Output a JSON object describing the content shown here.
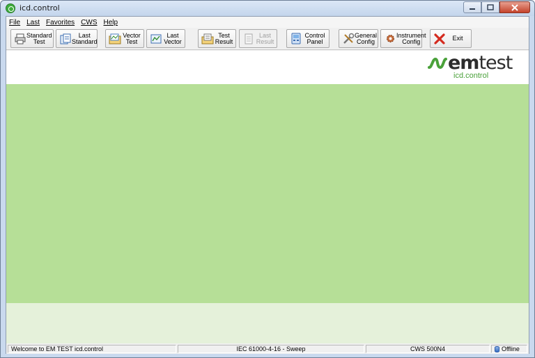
{
  "window": {
    "title": "icd.control"
  },
  "menu": [
    "File",
    "Last",
    "Favorites",
    "CWS",
    "Help"
  ],
  "toolbar": {
    "standard_test": [
      "Standard",
      "Test"
    ],
    "last_standard": [
      "Last",
      "Standard"
    ],
    "vector_test": [
      "Vector",
      "Test"
    ],
    "last_vector": [
      "Last",
      "Vector"
    ],
    "test_result": [
      "Test",
      "Result"
    ],
    "last_result": [
      "Last",
      "Result"
    ],
    "control_panel": [
      "Control",
      "Panel"
    ],
    "general_config": [
      "General",
      "Config"
    ],
    "instrument_config": [
      "Instrument",
      "Config"
    ],
    "exit": "Exit"
  },
  "logo": {
    "brand_em": "em",
    "brand_test": "test",
    "sub": "icd.control"
  },
  "status": {
    "message": "Welcome to EM TEST icd.control",
    "standard": "IEC 61000-4-16 - Sweep",
    "device": "CWS 500N4",
    "connection": "Offline"
  },
  "colors": {
    "main_area": "#b6df97",
    "lower_area": "#e5f1da",
    "brand_green": "#4aa13a",
    "exit_red": "#d42a1e"
  }
}
